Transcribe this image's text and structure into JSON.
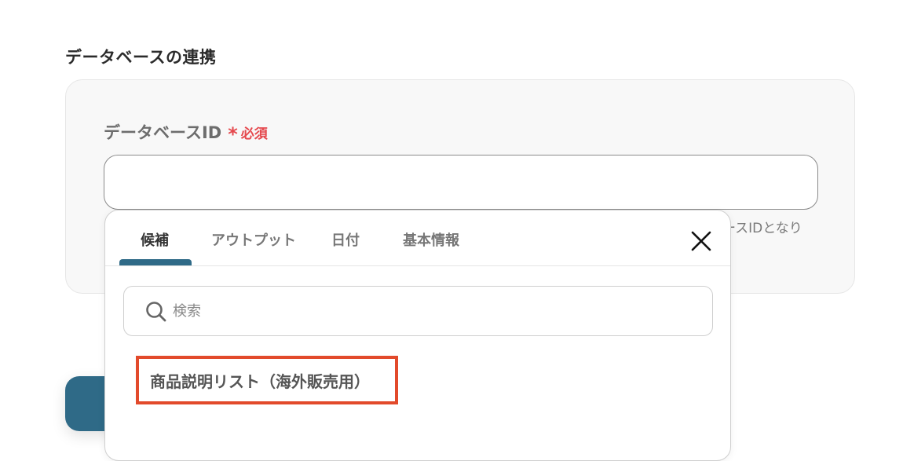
{
  "section": {
    "title": "データベースの連携"
  },
  "field": {
    "label": "データベースID",
    "required_star": "*",
    "required_text": "必須",
    "value": "",
    "help_text": "ースIDとなり"
  },
  "dropdown": {
    "tabs": [
      {
        "label": "候補",
        "active": true
      },
      {
        "label": "アウトプット",
        "active": false
      },
      {
        "label": "日付",
        "active": false
      },
      {
        "label": "基本情報",
        "active": false
      }
    ],
    "close_icon": "close-icon",
    "search": {
      "placeholder": "検索",
      "value": "",
      "icon": "search-icon"
    },
    "candidates": [
      {
        "label": "商品説明リスト（海外販売用）",
        "highlighted": true
      }
    ]
  },
  "colors": {
    "accent": "#2f6a87",
    "required": "#e5484d",
    "highlight_border": "#e24a2b"
  }
}
